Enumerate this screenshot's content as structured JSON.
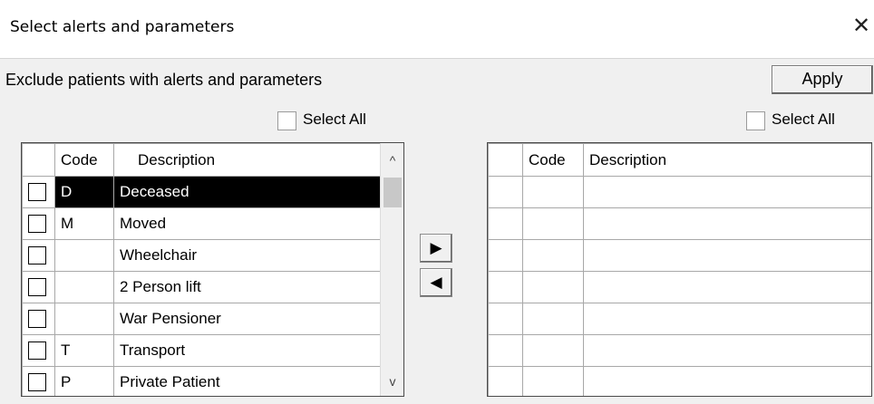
{
  "window": {
    "title": "Select alerts and parameters",
    "close_glyph": "✕"
  },
  "heading": "Exclude patients with alerts and parameters",
  "apply_label": "Apply",
  "left_panel": {
    "select_all_label": "Select All",
    "columns": [
      "Code",
      "Description"
    ],
    "rows": [
      {
        "code": "D",
        "description": "Deceased",
        "selected": true
      },
      {
        "code": "M",
        "description": "Moved"
      },
      {
        "code": "",
        "description": "Wheelchair"
      },
      {
        "code": "",
        "description": "2 Person lift"
      },
      {
        "code": "",
        "description": "War Pensioner"
      },
      {
        "code": "T",
        "description": "Transport"
      },
      {
        "code": "P",
        "description": "Private Patient"
      }
    ]
  },
  "right_panel": {
    "select_all_label": "Select All",
    "columns": [
      "Code",
      "Description"
    ]
  },
  "scroll_up_glyph": "^",
  "scroll_down_glyph": "v",
  "move_right_glyph": "▶",
  "move_left_glyph": "◀"
}
